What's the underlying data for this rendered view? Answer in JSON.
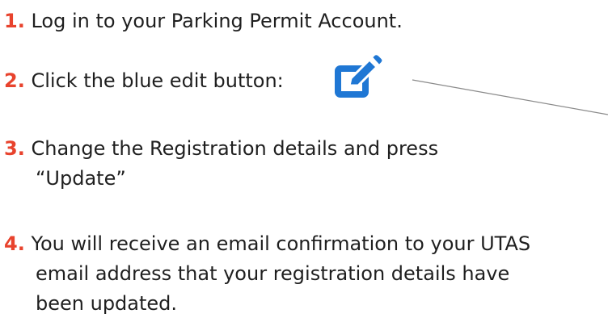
{
  "steps": [
    {
      "number": "1.",
      "text": "Log in to your Parking Permit Account."
    },
    {
      "number": "2.",
      "text": "Click the blue edit button:"
    },
    {
      "number": "3.",
      "text": "Change the Registration details and press",
      "text2": "“Update”"
    },
    {
      "number": "4.",
      "text": "You will receive an email confirmation to your UTAS",
      "text2": "email address that your registration details have",
      "text3": "been updated."
    }
  ],
  "icons": {
    "edit": "edit-icon"
  },
  "colors": {
    "step_number": "#e8432d",
    "edit_icon": "#1f77d4",
    "pointer_line": "#8a8a8a"
  }
}
